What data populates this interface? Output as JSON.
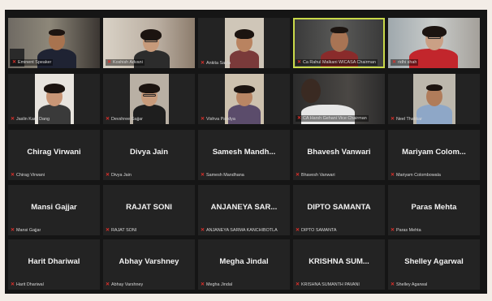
{
  "meeting": {
    "video_tiles": [
      {
        "name": "Eminent Speaker",
        "talking": false
      },
      {
        "name": "Koshish Advani",
        "talking": false
      },
      {
        "name": "Ankita Savla",
        "talking": false
      },
      {
        "name": "Ca Rahul Malkani WICASA Chairman",
        "talking": true
      },
      {
        "name": "ridhi shah",
        "talking": false
      },
      {
        "name": "Jaslin Kaur Dang",
        "talking": false
      },
      {
        "name": "Devshree Gajjar",
        "talking": false
      },
      {
        "name": "Vishva Pandya",
        "talking": false
      },
      {
        "name": "CA Harsh Gehani Vice Chairman",
        "talking": false
      },
      {
        "name": "Neel Thakkar",
        "talking": false
      }
    ],
    "name_tiles": [
      {
        "display": "Chirag Virwani",
        "label": "Chirag Virwani"
      },
      {
        "display": "Divya Jain",
        "label": "Divya Jain"
      },
      {
        "display": "Samesh Mandh...",
        "label": "Samesh Mandhana"
      },
      {
        "display": "Bhavesh Vanwari",
        "label": "Bhavesh Vanwari"
      },
      {
        "display": "Mariyam Colom...",
        "label": "Mariyam Colombowala"
      },
      {
        "display": "Mansi Gajjar",
        "label": "Mansi Gajjar"
      },
      {
        "display": "RAJAT SONI",
        "label": "RAJAT SONI"
      },
      {
        "display": "ANJANEYA SAR...",
        "label": "ANJANEYA SARMA KANCHIBOTLA"
      },
      {
        "display": "DIPTO SAMANTA",
        "label": "DIPTO SAMANTA"
      },
      {
        "display": "Paras Mehta",
        "label": "Paras Mehta"
      },
      {
        "display": "Harit Dhariwal",
        "label": "Harit Dhariwal"
      },
      {
        "display": "Abhay Varshney",
        "label": "Abhay Varshney"
      },
      {
        "display": "Megha Jindal",
        "label": "Megha Jindal"
      },
      {
        "display": "KRISHNA SUM...",
        "label": "KRISHNA SUMANTH PAVANI"
      },
      {
        "display": "Shelley Agarwal",
        "label": "Shelley Agarwal"
      }
    ],
    "colors": {
      "muted_mic": "#e0302a",
      "active_speaker": "#c9d94a",
      "tile_bg": "#232323"
    }
  }
}
